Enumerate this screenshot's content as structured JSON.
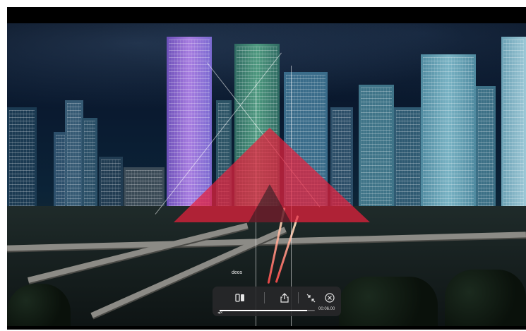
{
  "video": {
    "label": "deos",
    "time": "00:06.00",
    "progress": 0.92,
    "overlay_color": "#e8203c"
  },
  "controls": {
    "split_view_icon": "split-view-icon",
    "share_icon": "share-icon",
    "shrink_icon": "shrink-arrows-icon",
    "close_icon": "close-circle-icon",
    "mute_icon": "speaker-mute-icon"
  }
}
